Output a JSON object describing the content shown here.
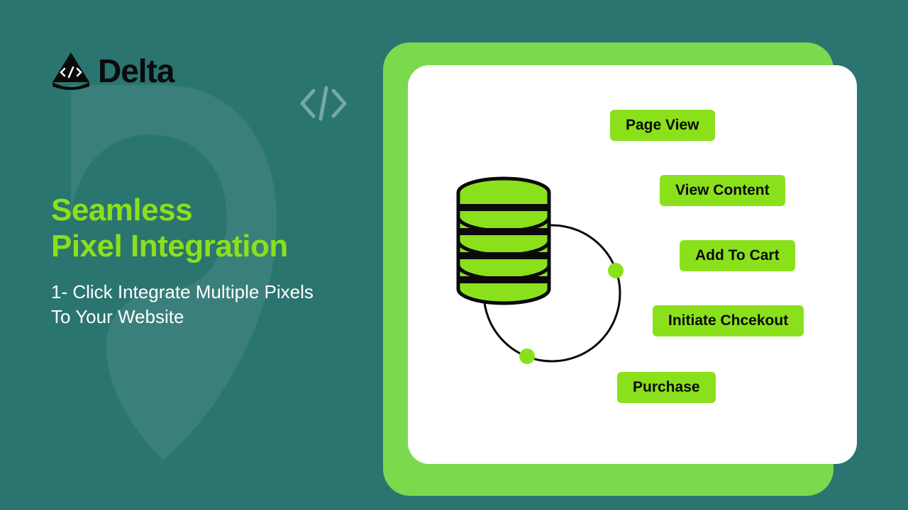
{
  "logo": {
    "text": "Delta"
  },
  "headline": {
    "line1": "Seamless",
    "line2": "Pixel Integration"
  },
  "subhead": {
    "line1": "1- Click Integrate Multiple Pixels",
    "line2": "To Your Website"
  },
  "events": [
    "Page View",
    "View Content",
    "Add To Cart",
    "Initiate Chcekout",
    "Purchase"
  ],
  "colors": {
    "bg": "#2b7571",
    "accent": "#8be01c",
    "cardBack": "#7bd94e",
    "cardFront": "#ffffff"
  }
}
